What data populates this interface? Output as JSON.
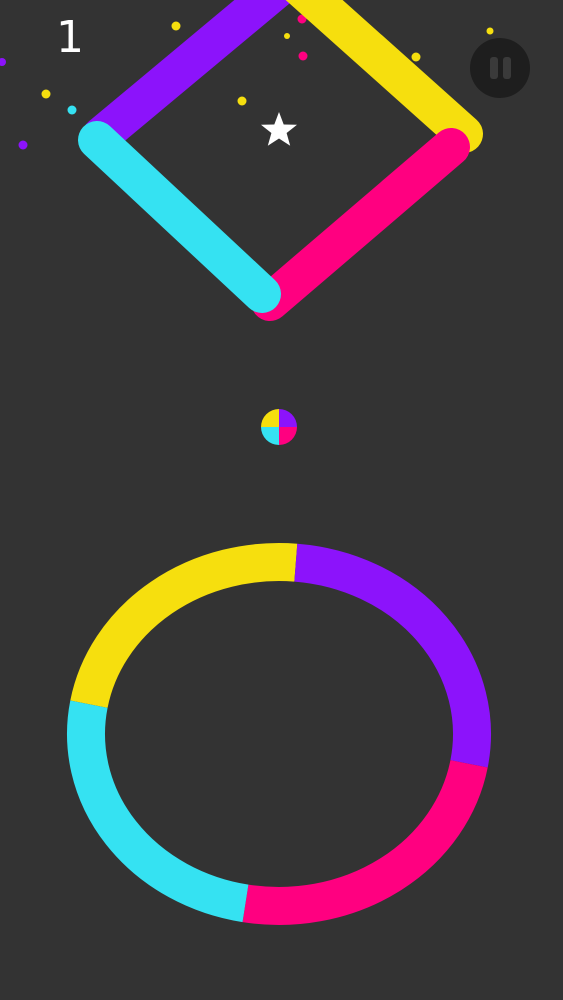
{
  "hud": {
    "score": "1"
  },
  "icons": {
    "pause": "pause-icon",
    "star": "star-icon",
    "ball": "player-ball"
  },
  "colors": {
    "background": "#333333",
    "purple": "#8c13fb",
    "yellow": "#f6df0e",
    "cyan": "#35e2f2",
    "pink": "#ff0080",
    "white": "#ffffff"
  },
  "obstacles": {
    "square": {
      "segment_colors": [
        "purple",
        "yellow",
        "pink",
        "cyan"
      ]
    },
    "ring": {
      "segment_colors": [
        "yellow",
        "purple",
        "pink",
        "cyan"
      ]
    }
  },
  "player": {
    "quadrant_colors": [
      "yellow",
      "purple",
      "pink",
      "cyan"
    ]
  }
}
